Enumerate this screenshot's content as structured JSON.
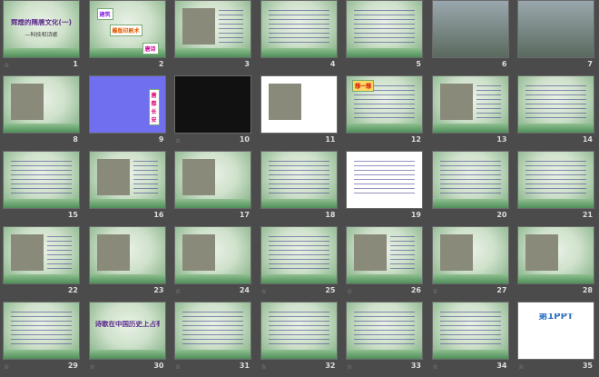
{
  "view": "slide-sorter",
  "slides": [
    {
      "n": "1",
      "theme": "green",
      "title": "辉煌的隋唐文化(一)",
      "sub": "—科技和诗歌",
      "star": true
    },
    {
      "n": "2",
      "theme": "green",
      "boxes": [
        "建筑",
        "雕版印刷术",
        "唐诗"
      ]
    },
    {
      "n": "3",
      "theme": "green",
      "pic": true,
      "lines": true
    },
    {
      "n": "4",
      "theme": "green",
      "lines": true
    },
    {
      "n": "5",
      "theme": "green",
      "lines": true
    },
    {
      "n": "6",
      "theme": "photo"
    },
    {
      "n": "7",
      "theme": "photo"
    },
    {
      "n": "8",
      "theme": "green",
      "pic": true
    },
    {
      "n": "9",
      "theme": "blue",
      "boxes": [
        "唐都长安"
      ]
    },
    {
      "n": "10",
      "theme": "black",
      "star": true
    },
    {
      "n": "11",
      "theme": "white",
      "pic": true
    },
    {
      "n": "12",
      "theme": "green",
      "boxes": [
        "想一想"
      ],
      "lines": true
    },
    {
      "n": "13",
      "theme": "green",
      "pic": true,
      "lines": true
    },
    {
      "n": "14",
      "theme": "green",
      "lines": true
    },
    {
      "n": "15",
      "theme": "green",
      "lines": true
    },
    {
      "n": "16",
      "theme": "green",
      "pic": true,
      "lines": true
    },
    {
      "n": "17",
      "theme": "green",
      "pic": true
    },
    {
      "n": "18",
      "theme": "green",
      "lines": true
    },
    {
      "n": "19",
      "theme": "white",
      "lines": true
    },
    {
      "n": "20",
      "theme": "green",
      "lines": true
    },
    {
      "n": "21",
      "theme": "green",
      "lines": true
    },
    {
      "n": "22",
      "theme": "green",
      "pic": true,
      "lines": true
    },
    {
      "n": "23",
      "theme": "green",
      "pic": true
    },
    {
      "n": "24",
      "theme": "green",
      "pic": true,
      "star": true
    },
    {
      "n": "25",
      "theme": "green",
      "lines": true,
      "star": true
    },
    {
      "n": "26",
      "theme": "green",
      "pic": true,
      "lines": true,
      "star": true
    },
    {
      "n": "27",
      "theme": "green",
      "pic": true,
      "star": true
    },
    {
      "n": "28",
      "theme": "green",
      "pic": true
    },
    {
      "n": "29",
      "theme": "green",
      "lines": true,
      "star": true
    },
    {
      "n": "30",
      "theme": "green",
      "title": "诗歌在中国历史上占有",
      "star": true
    },
    {
      "n": "31",
      "theme": "green",
      "lines": true,
      "star": true
    },
    {
      "n": "32",
      "theme": "green",
      "lines": true,
      "star": true
    },
    {
      "n": "33",
      "theme": "green",
      "lines": true,
      "star": true
    },
    {
      "n": "34",
      "theme": "green",
      "lines": true,
      "star": true
    },
    {
      "n": "35",
      "theme": "white",
      "title": "第1PPT",
      "star": true
    }
  ],
  "icons": {
    "transition": "☆"
  }
}
